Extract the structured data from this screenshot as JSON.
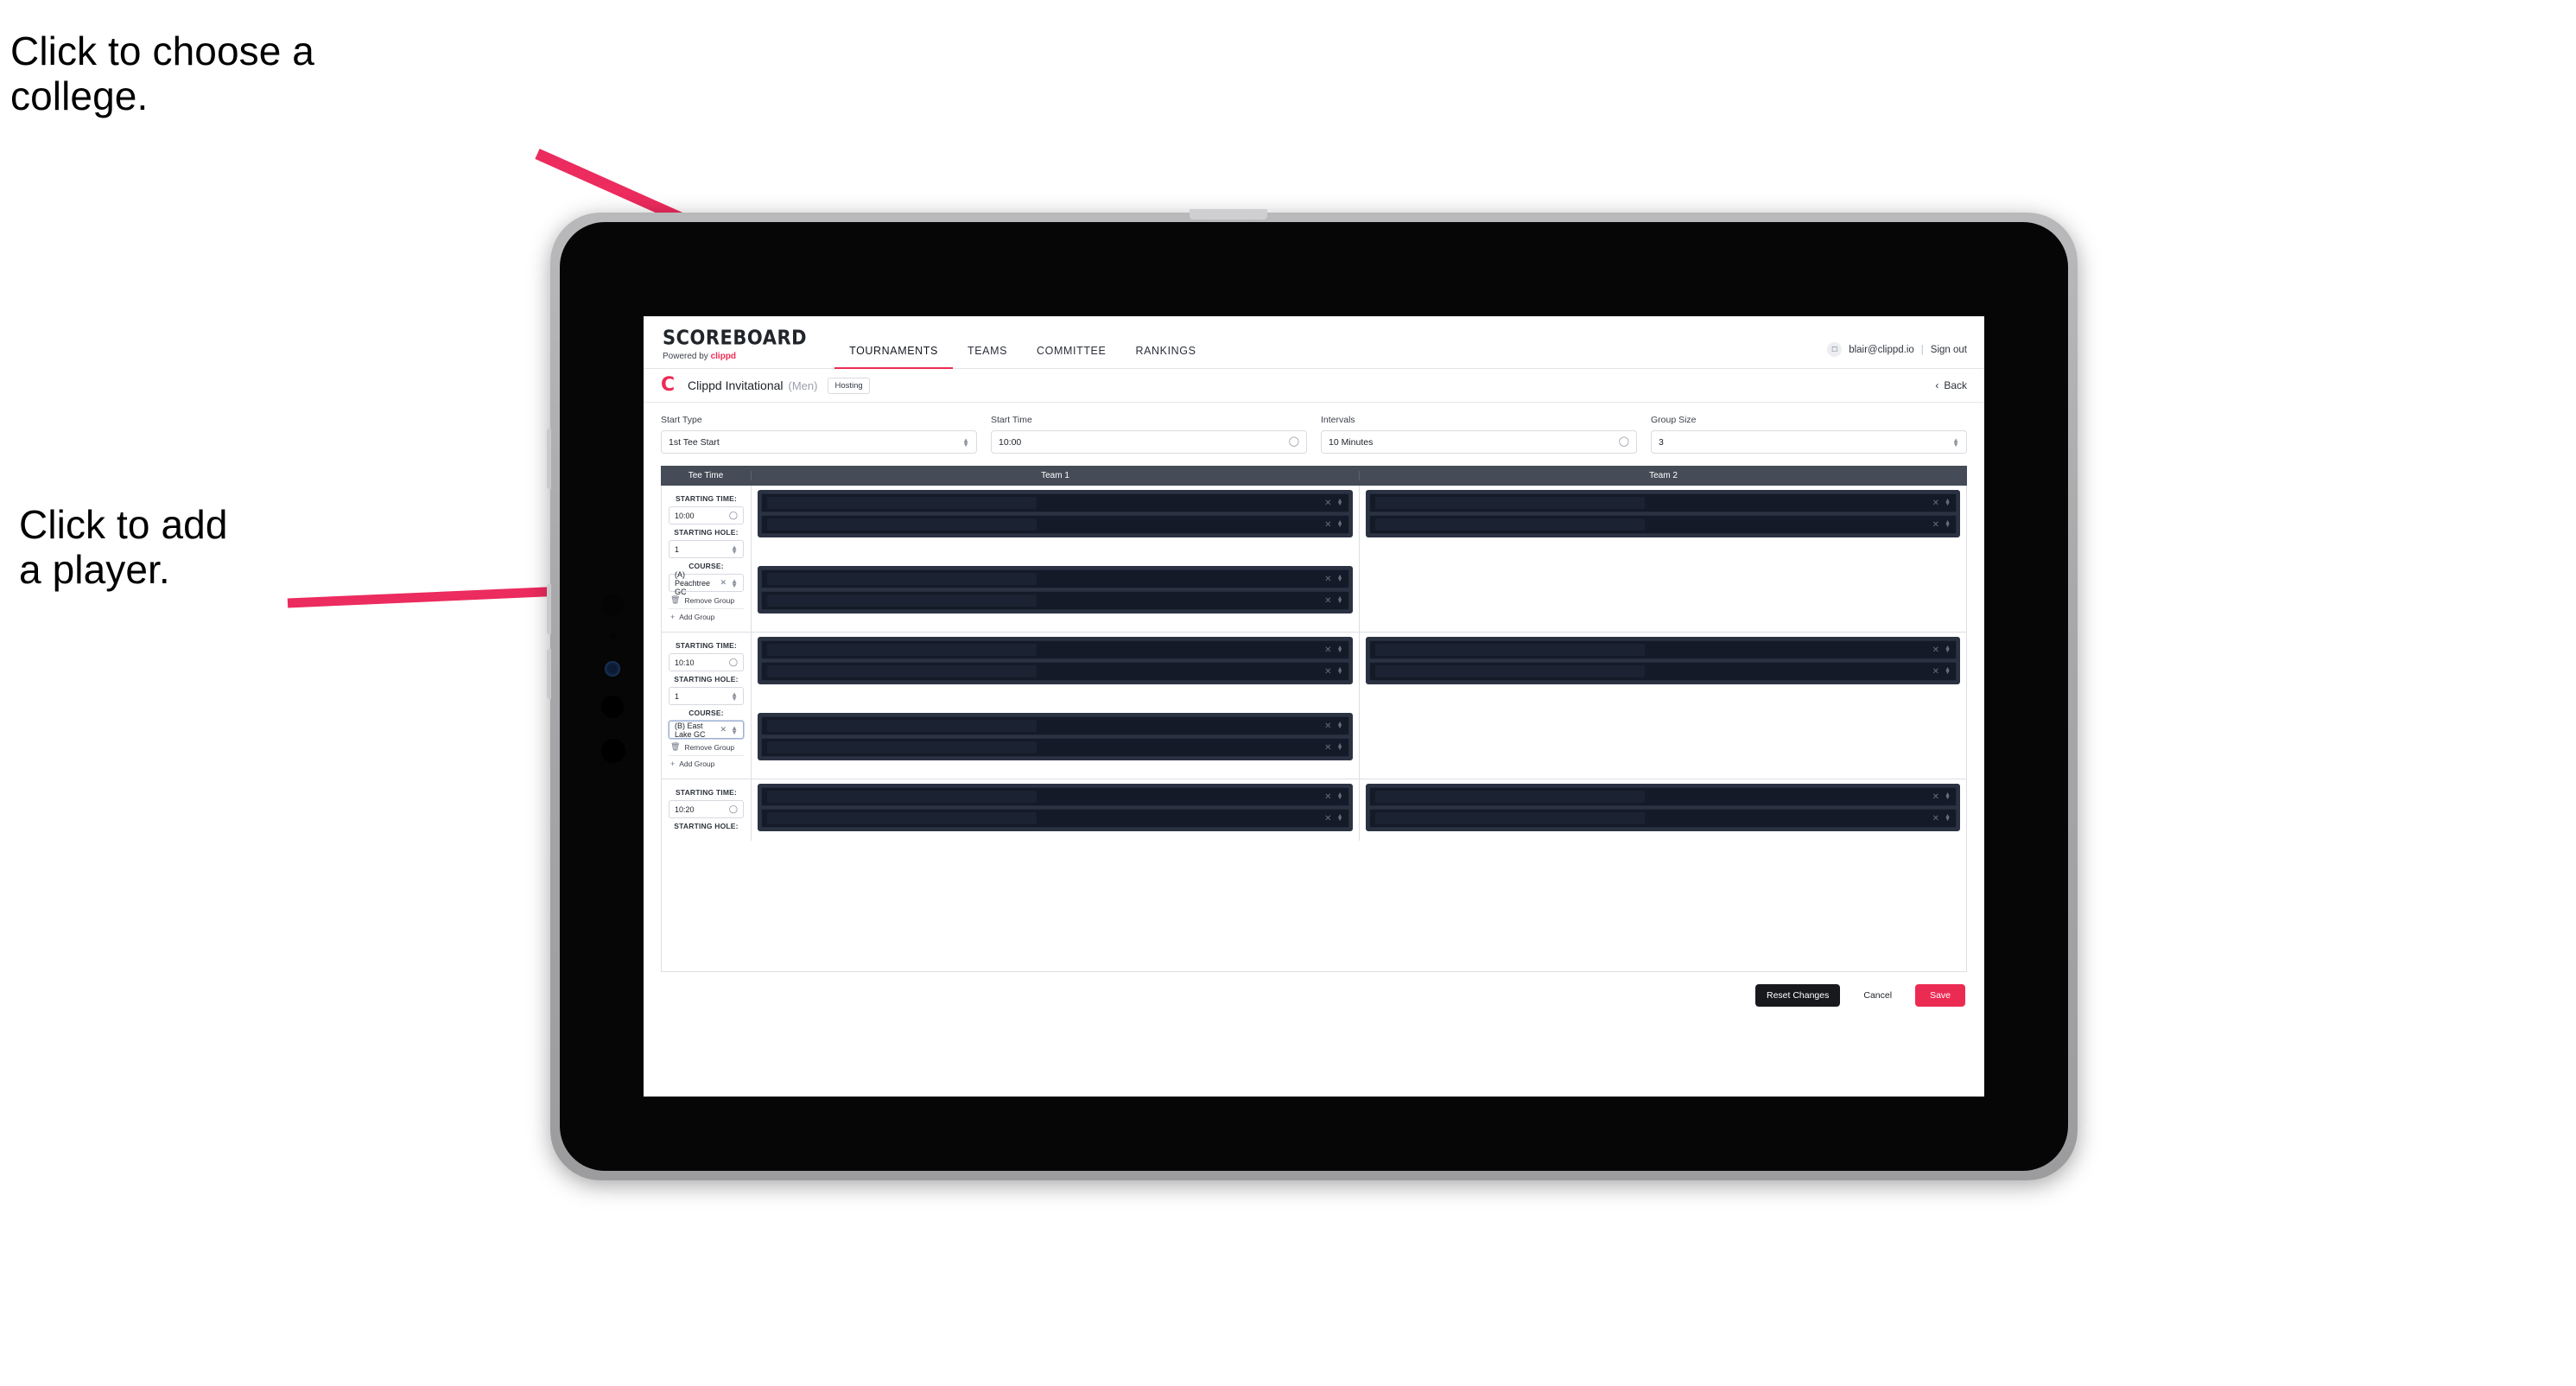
{
  "annotations": {
    "choose_college": "Click to choose a\ncollege.",
    "add_player": "Click to add\na player."
  },
  "colors": {
    "accent": "#ec2b53",
    "nav_bar": "#454b57",
    "dark_button": "#17191d",
    "redacted": "#141a27",
    "annotation_arrow": "#ec2b5e"
  },
  "app": {
    "brand": {
      "title": "SCOREBOARD",
      "sub_prefix": "Powered by ",
      "sub_brand": "clippd",
      "logo_letter": "C"
    },
    "nav": [
      {
        "label": "TOURNAMENTS",
        "active": true
      },
      {
        "label": "TEAMS",
        "active": false
      },
      {
        "label": "COMMITTEE",
        "active": false
      },
      {
        "label": "RANKINGS",
        "active": false
      }
    ],
    "account": {
      "avatar_icon": "user-icon",
      "email": "blair@clippd.io",
      "divider": "|",
      "sign_out": "Sign out"
    },
    "tournament_bar": {
      "name": "Clippd Invitational",
      "gender": "(Men)",
      "badge": "Hosting",
      "back_label": "Back",
      "back_icon": "chevron-left-icon"
    },
    "form": [
      {
        "label": "Start Type",
        "value": "1st Tee Start",
        "icon": "stepper-icon"
      },
      {
        "label": "Start Time",
        "value": "10:00",
        "icon": "clock-icon"
      },
      {
        "label": "Intervals",
        "value": "10 Minutes",
        "icon": "clock-icon"
      },
      {
        "label": "Group Size",
        "value": "3",
        "icon": "stepper-icon"
      }
    ],
    "table": {
      "headers": [
        "Tee Time",
        "Team 1",
        "Team 2"
      ],
      "sublabels": {
        "time": "STARTING TIME:",
        "hole": "STARTING HOLE:",
        "course": "COURSE:"
      },
      "group_actions": {
        "remove": "Remove Group",
        "remove_icon": "trash-icon",
        "add": "Add Group",
        "add_icon": "plus-icon"
      },
      "player_row_icons": {
        "clear": "close-icon",
        "stepper": "stepper-icon"
      },
      "rows": [
        {
          "starting_time": "10:00",
          "starting_hole": "1",
          "course": "(A) Peachtree GC",
          "course_focused": false,
          "course_clear_icon": "close-icon",
          "team1_groups": [
            {
              "players": [
                "",
                ""
              ]
            },
            {
              "players": [
                "",
                ""
              ]
            }
          ],
          "team2_groups": [
            {
              "players": [
                "",
                ""
              ]
            }
          ]
        },
        {
          "starting_time": "10:10",
          "starting_hole": "1",
          "course": "(B) East Lake GC",
          "course_focused": true,
          "course_clear_icon": "close-icon",
          "team1_groups": [
            {
              "players": [
                "",
                ""
              ]
            },
            {
              "players": [
                "",
                ""
              ]
            }
          ],
          "team2_groups": [
            {
              "players": [
                "",
                ""
              ]
            }
          ]
        },
        {
          "starting_time": "10:20",
          "starting_hole": "",
          "course": "",
          "course_focused": false,
          "course_clear_icon": "close-icon",
          "team1_groups": [
            {
              "players": [
                "",
                ""
              ]
            }
          ],
          "team2_groups": [
            {
              "players": [
                "",
                ""
              ]
            }
          ]
        }
      ]
    },
    "footer": {
      "reset": "Reset Changes",
      "cancel": "Cancel",
      "save": "Save"
    }
  }
}
